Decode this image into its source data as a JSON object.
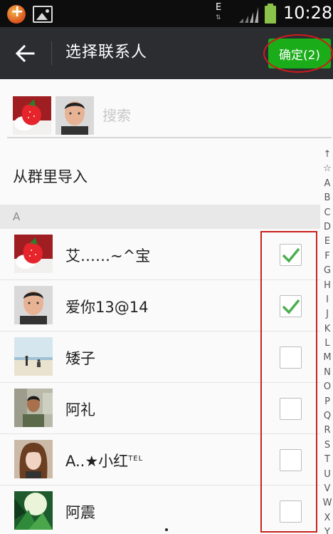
{
  "status_bar": {
    "network_type": "E",
    "time": "10:28"
  },
  "action_bar": {
    "title": "选择联系人",
    "confirm_label": "确定(2)"
  },
  "search": {
    "placeholder": "搜索"
  },
  "import_from_group": "从群里导入",
  "section": "A",
  "contacts": [
    {
      "name": "艾……~^宝",
      "checked": true,
      "avatar": "strawberry"
    },
    {
      "name": "爱你13@14",
      "checked": true,
      "avatar": "man-portrait"
    },
    {
      "name": "矮子",
      "checked": false,
      "avatar": "beach-couple"
    },
    {
      "name": "阿礼",
      "checked": false,
      "avatar": "man-outdoor"
    },
    {
      "name": "A..★小红",
      "name_suffix": "TEL",
      "checked": false,
      "avatar": "girl-portrait"
    },
    {
      "name": "阿震",
      "checked": false,
      "avatar": "green-leaves"
    }
  ],
  "alphabet_index": [
    "↑",
    "☆",
    "A",
    "B",
    "C",
    "D",
    "E",
    "F",
    "G",
    "H",
    "I",
    "J",
    "K",
    "L",
    "M",
    "N",
    "O",
    "P",
    "Q",
    "R",
    "S",
    "T",
    "U",
    "V",
    "W",
    "X",
    "Y"
  ],
  "colors": {
    "accent_green": "#1aad19",
    "action_bar": "#2b2d31",
    "annotation_red": "#c9221e"
  }
}
